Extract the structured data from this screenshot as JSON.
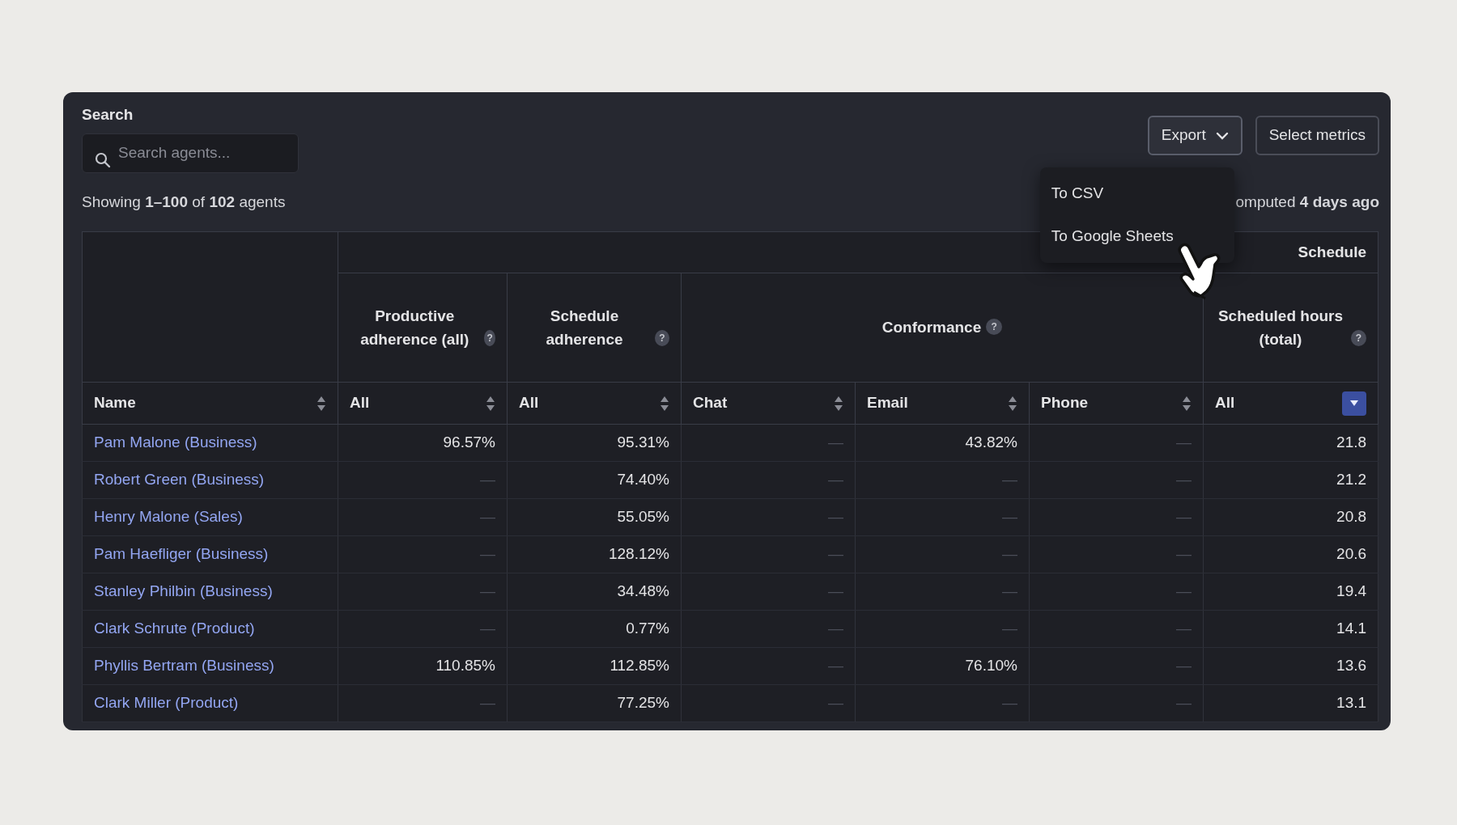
{
  "search": {
    "label": "Search",
    "placeholder": "Search agents..."
  },
  "buttons": [
    {
      "label": "Export",
      "kind": "dropdown",
      "expanded": true
    },
    {
      "label": "Select metrics",
      "kind": "plain"
    }
  ],
  "export_menu": [
    "To CSV",
    "To Google Sheets"
  ],
  "summary": "Showing **1–100** of **102** agents",
  "computed": "omputed **4 days ago**",
  "table": {
    "group_header": "Schedule",
    "name_column": {
      "label": "Name",
      "sorted": false
    },
    "metrics": [
      {
        "label": "Productive adherence (all)",
        "help": "?",
        "columns": [
          {
            "label": "All",
            "sorted": false
          }
        ]
      },
      {
        "label": "Schedule adherence",
        "help": "?",
        "columns": [
          {
            "label": "All",
            "sorted": false
          }
        ]
      },
      {
        "label": "Conformance",
        "help": "?",
        "columns": [
          {
            "label": "Chat",
            "sorted": false
          },
          {
            "label": "Email",
            "sorted": false
          },
          {
            "label": "Phone",
            "sorted": false
          }
        ]
      },
      {
        "label": "Scheduled hours (total)",
        "help": "?",
        "columns": [
          {
            "label": "All",
            "sorted": true
          }
        ]
      }
    ],
    "rows": [
      {
        "name": "Pam Malone (Business)",
        "values": [
          "96.57%",
          "95.31%",
          "—",
          "43.82%",
          "—",
          "21.8"
        ]
      },
      {
        "name": "Robert Green (Business)",
        "values": [
          "—",
          "74.40%",
          "—",
          "—",
          "—",
          "21.2"
        ]
      },
      {
        "name": "Henry Malone (Sales)",
        "values": [
          "—",
          "55.05%",
          "—",
          "—",
          "—",
          "20.8"
        ]
      },
      {
        "name": "Pam Haefliger (Business)",
        "values": [
          "—",
          "128.12%",
          "—",
          "—",
          "—",
          "20.6"
        ]
      },
      {
        "name": "Stanley Philbin (Business)",
        "values": [
          "—",
          "34.48%",
          "—",
          "—",
          "—",
          "19.4"
        ]
      },
      {
        "name": "Clark Schrute (Product)",
        "values": [
          "—",
          "0.77%",
          "—",
          "—",
          "—",
          "14.1"
        ]
      },
      {
        "name": "Phyllis Bertram (Business)",
        "values": [
          "110.85%",
          "112.85%",
          "—",
          "76.10%",
          "—",
          "13.6"
        ]
      },
      {
        "name": "Clark Miller (Product)",
        "values": [
          "—",
          "77.25%",
          "—",
          "—",
          "—",
          "13.1"
        ]
      }
    ]
  }
}
